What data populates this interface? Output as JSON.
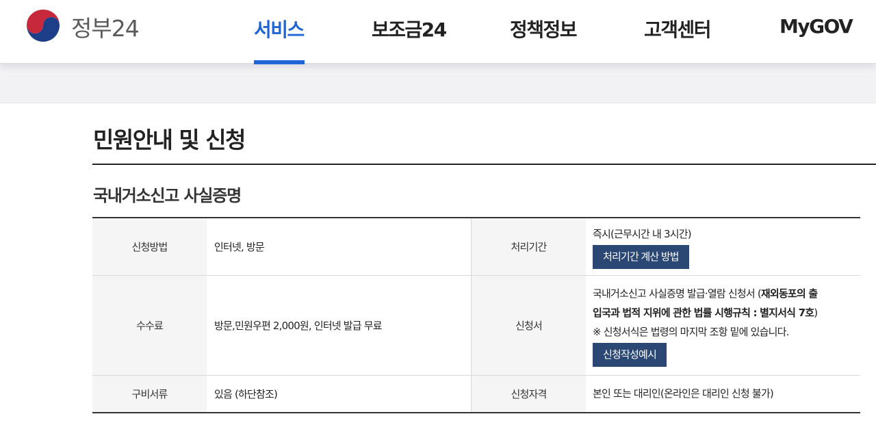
{
  "header": {
    "logo_text": "정부24",
    "nav": [
      {
        "label": "서비스",
        "active": true
      },
      {
        "label": "보조금24",
        "active": false
      },
      {
        "label": "정책정보",
        "active": false
      },
      {
        "label": "고객센터",
        "active": false
      },
      {
        "label": "MyGOV",
        "active": false
      }
    ]
  },
  "page": {
    "title": "민원안내 및 신청",
    "service_name": "국내거소신고 사실증명"
  },
  "table": {
    "method_label": "신청방법",
    "method_value": "인터넷, 방문",
    "period_label": "처리기간",
    "period_value": "즉시(근무시간 내 3시간)",
    "period_button": "처리기간 계산 방법",
    "fee_label": "수수료",
    "fee_value": "방문,민원우편 2,000원, 인터넷 발급 무료",
    "form_label": "신청서",
    "form_text_plain": "국내거소신고 사실증명 발급·열람 신청서 (",
    "form_text_bold_1": "재외동포의 출",
    "form_text_bold_2": "입국과 법적 지위에 관한 법률 시행규칙 : 별지서식 7호",
    "form_text_close": ")",
    "form_note": "※ 신청서식은 법령의 마지막 조항 밑에 있습니다.",
    "form_button": "신청작성예시",
    "docs_label": "구비서류",
    "docs_value": "있음 (하단참조)",
    "eligibility_label": "신청자격",
    "eligibility_value": "본인 또는 대리인(온라인은 대리인 신청 불가)"
  },
  "colors": {
    "brand_blue": "#1f65d6",
    "button_navy": "#2b4774",
    "logo_red": "#c8283c",
    "logo_blue": "#1d3f8a"
  }
}
